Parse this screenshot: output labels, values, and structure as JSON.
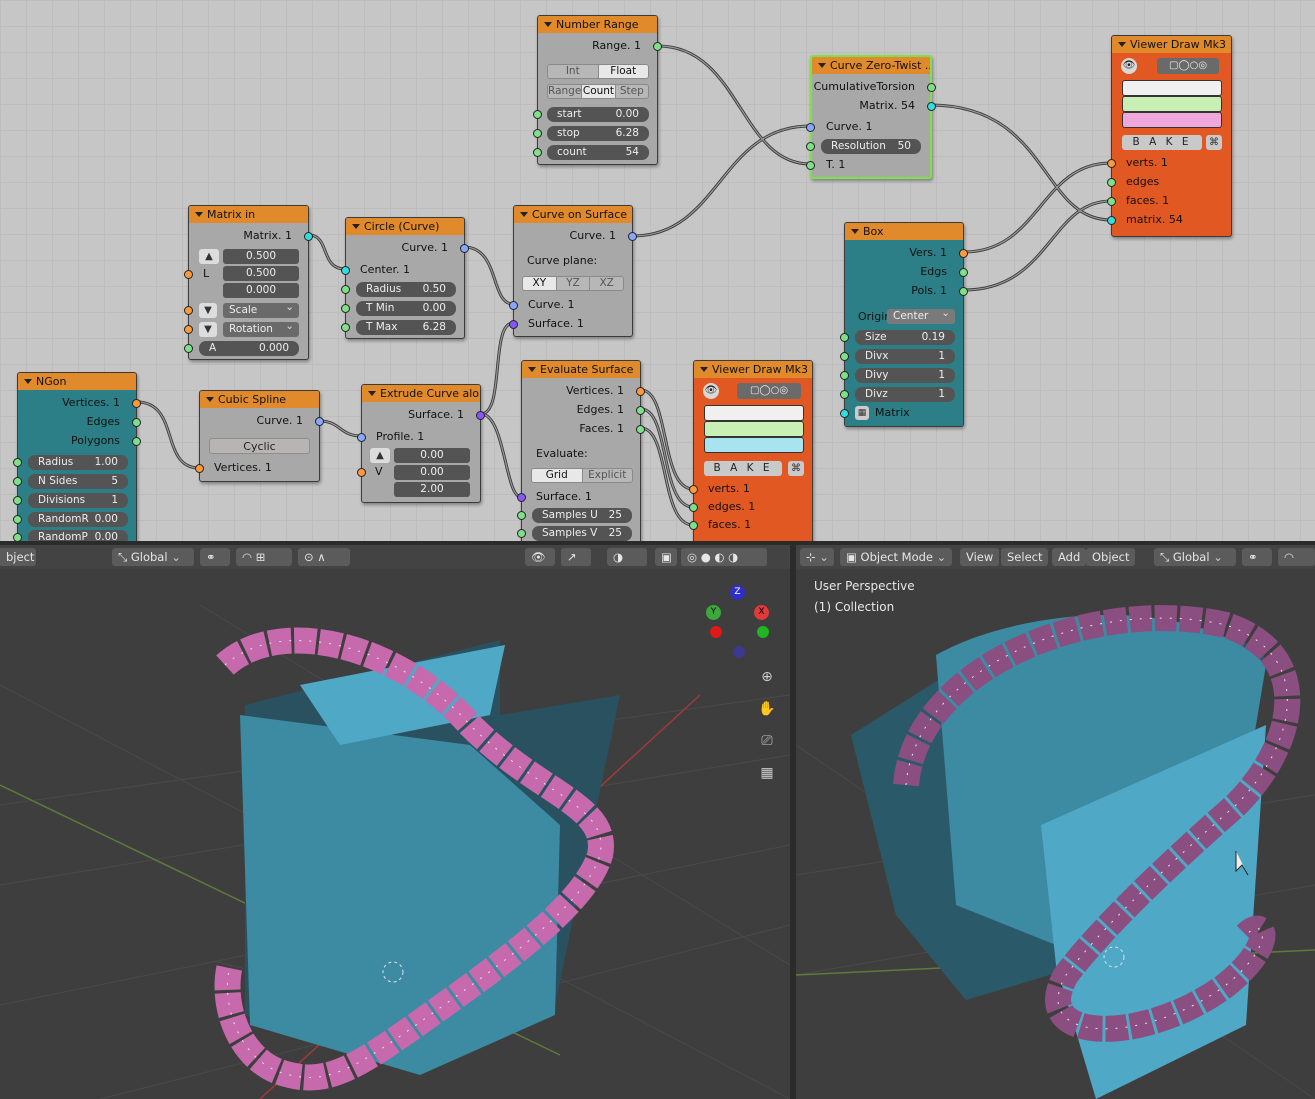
{
  "nodes": {
    "number_range": {
      "title": "Number Range",
      "out_range": "Range. 1",
      "mode_int": "Int",
      "mode_float": "Float",
      "tab_range": "Range",
      "tab_count": "Count",
      "tab_step": "Step",
      "start_label": "start",
      "start_value": "0.00",
      "stop_label": "stop",
      "stop_value": "6.28",
      "count_label": "count",
      "count_value": "54"
    },
    "curve_zero_twist": {
      "title": "Curve Zero-Twist ..",
      "out_torsion": "CumulativeTorsion",
      "out_matrix": "Matrix. 54",
      "in_curve": "Curve. 1",
      "resolution_label": "Resolution",
      "resolution_value": "50",
      "in_t": "T. 1"
    },
    "viewer_top": {
      "title": "Viewer Draw Mk3",
      "bake": "B A K E",
      "in_verts": "verts. 1",
      "in_edges": "edges",
      "in_faces": "faces. 1",
      "in_matrix": "matrix. 54",
      "colors": [
        "#f0f0f0",
        "#c8f0b4",
        "#f0a8dc"
      ]
    },
    "matrix_in": {
      "title": "Matrix in",
      "out_matrix": "Matrix. 1",
      "l_label": "L",
      "l_values": [
        "0.500",
        "0.500",
        "0.000"
      ],
      "scale_label": "Scale",
      "rotation_label": "Rotation",
      "a_label": "A",
      "a_value": "0.000"
    },
    "circle": {
      "title": "Circle (Curve)",
      "out_curve": "Curve. 1",
      "in_center": "Center. 1",
      "radius_label": "Radius",
      "radius_value": "0.50",
      "tmin_label": "T Min",
      "tmin_value": "0.00",
      "tmax_label": "T Max",
      "tmax_value": "6.28"
    },
    "curve_on_surface": {
      "title": "Curve on Surface",
      "out_curve": "Curve. 1",
      "plane_label": "Curve plane:",
      "plane_xy": "XY",
      "plane_yz": "YZ",
      "plane_xz": "XZ",
      "in_curve": "Curve. 1",
      "in_surface": "Surface. 1"
    },
    "box": {
      "title": "Box",
      "out_vers": "Vers. 1",
      "out_edgs": "Edgs",
      "out_pols": "Pols. 1",
      "origin_label": "Origin",
      "origin_value": "Center",
      "size_label": "Size",
      "size_value": "0.19",
      "divx_label": "Divx",
      "divx_value": "1",
      "divy_label": "Divy",
      "divy_value": "1",
      "divz_label": "Divz",
      "divz_value": "1",
      "in_matrix": "Matrix"
    },
    "ngon": {
      "title": "NGon",
      "out_vertices": "Vertices. 1",
      "out_edges": "Edges",
      "out_polygons": "Polygons",
      "radius_label": "Radius",
      "radius_value": "1.00",
      "nsides_label": "N Sides",
      "nsides_value": "5",
      "divisions_label": "Divisions",
      "divisions_value": "1",
      "randomr_label": "RandomR",
      "randomr_value": "0.00",
      "randomp_label": "RandomP",
      "randomp_value": "0.00"
    },
    "cubic_spline": {
      "title": "Cubic Spline",
      "out_curve": "Curve. 1",
      "cyclic": "Cyclic",
      "in_vertices": "Vertices. 1"
    },
    "extrude": {
      "title": "Extrude Curve alo..",
      "out_surface": "Surface. 1",
      "in_profile": "Profile. 1",
      "v_label": "V",
      "v_values": [
        "0.00",
        "0.00",
        "2.00"
      ]
    },
    "evaluate_surface": {
      "title": "Evaluate Surface",
      "out_vertices": "Vertices. 1",
      "out_edges": "Edges. 1",
      "out_faces": "Faces. 1",
      "evaluate_label": "Evaluate:",
      "grid": "Grid",
      "explicit": "Explicit",
      "in_surface": "Surface. 1",
      "samples_u_label": "Samples U",
      "samples_u_value": "25",
      "samples_v_label": "Samples V",
      "samples_v_value": "25"
    },
    "viewer_bottom": {
      "title": "Viewer Draw Mk3",
      "bake": "B A K E",
      "in_verts": "verts. 1",
      "in_edges": "edges. 1",
      "in_faces": "faces. 1",
      "colors": [
        "#f0f0f0",
        "#c8f0b4",
        "#a8e4f0"
      ]
    }
  },
  "viewport_left": {
    "mode_partial": "bject",
    "transform": "Global"
  },
  "viewport_right": {
    "mode": "Object Mode",
    "menu_view": "View",
    "menu_select": "Select",
    "menu_add": "Add",
    "menu_object": "Object",
    "transform": "Global",
    "perspective": "User Perspective",
    "collection": "(1) Collection"
  },
  "gizmo": {
    "z": "Z",
    "y": "Y",
    "x": "X"
  }
}
